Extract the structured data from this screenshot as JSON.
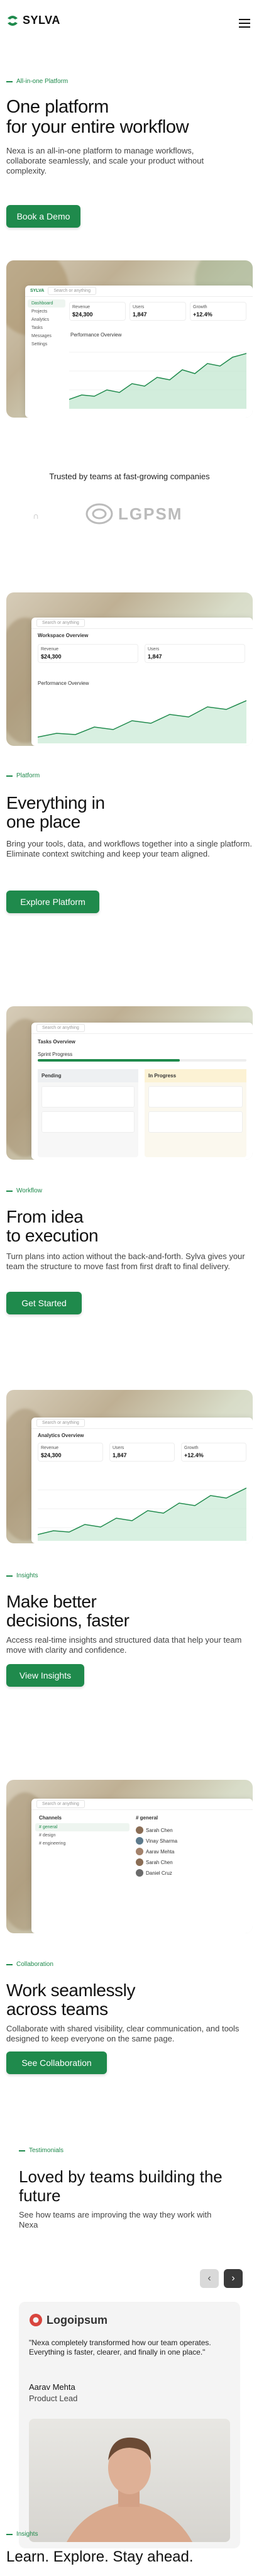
{
  "brand": {
    "name": "SYLVA"
  },
  "hero": {
    "eyebrow": "All-in-one Platform",
    "title_line1": "One platform",
    "title_line2": "for your entire workflow",
    "description": "Nexa is an all-in-one platform to manage workflows, collaborate seamlessly, and scale your product without complexity.",
    "cta": "Book a Demo"
  },
  "dash1": {
    "search": "Search or anything",
    "sidebar": [
      "Dashboard",
      "Projects",
      "Analytics",
      "Tasks",
      "Messages",
      "Settings"
    ],
    "kpis": [
      {
        "label": "Revenue",
        "value": "$24,300"
      },
      {
        "label": "Users",
        "value": "1,847"
      },
      {
        "label": "Growth",
        "value": "+12.4%"
      }
    ],
    "panel_title": "Performance Overview"
  },
  "trusted": {
    "title": "Trusted by teams at fast-growing companies",
    "logo": "LGPSM"
  },
  "sections": [
    {
      "eyebrow": "Platform",
      "title_line1": "Everything in",
      "title_line2": "one place",
      "description": "Bring your tools, data, and workflows together into a single platform. Eliminate context switching and keep your team aligned.",
      "cta": "Explore Platform",
      "win_title": "Workspace Overview",
      "win_sub": "Performance Overview"
    },
    {
      "eyebrow": "Workflow",
      "title_line1": "From idea",
      "title_line2": "to execution",
      "description": "Turn plans into action without the back-and-forth. Sylva gives your team the structure to move fast from first draft to final delivery.",
      "cta": "Get Started",
      "win_title": "Tasks Overview",
      "win_sub": "Sprint Progress",
      "col1": "Pending",
      "col2": "In Progress"
    },
    {
      "eyebrow": "Insights",
      "title_line1": "Make better",
      "title_line2": "decisions, faster",
      "description": "Access real-time insights and structured data that help your team move with clarity and confidence.",
      "cta": "View Insights",
      "win_title": "Analytics Overview"
    },
    {
      "eyebrow": "Collaboration",
      "title_line1": "Work seamlessly",
      "title_line2": "across teams",
      "description": "Collaborate with shared visibility, clear communication, and tools designed to keep everyone on the same page.",
      "cta": "See Collaboration",
      "channels_title": "Channels",
      "channels": [
        "# general",
        "# design",
        "# engineering"
      ],
      "feed_title": "# general",
      "feed": [
        "Sarah Chen",
        "Vinay Sharma",
        "Aarav Mehta",
        "Sarah Chen",
        "Daniel Cruz"
      ]
    }
  ],
  "testimonials": {
    "eyebrow": "Testimonials",
    "title_line1": "Loved by teams building the",
    "title_line2": "future",
    "description": "See how teams are improving the way they work with Nexa",
    "card": {
      "logo": "Logoipsum",
      "quote": "\"Nexa completely transformed how our team operates. Everything is faster, clearer, and finally in one place.\"",
      "name": "Aarav Mehta",
      "role": "Product Lead"
    }
  },
  "insights_footer": {
    "eyebrow": "Insights",
    "title": "Learn. Explore. Stay ahead."
  },
  "colors": {
    "accent": "#1f8a4c",
    "text": "#111111",
    "muted": "#444444"
  }
}
